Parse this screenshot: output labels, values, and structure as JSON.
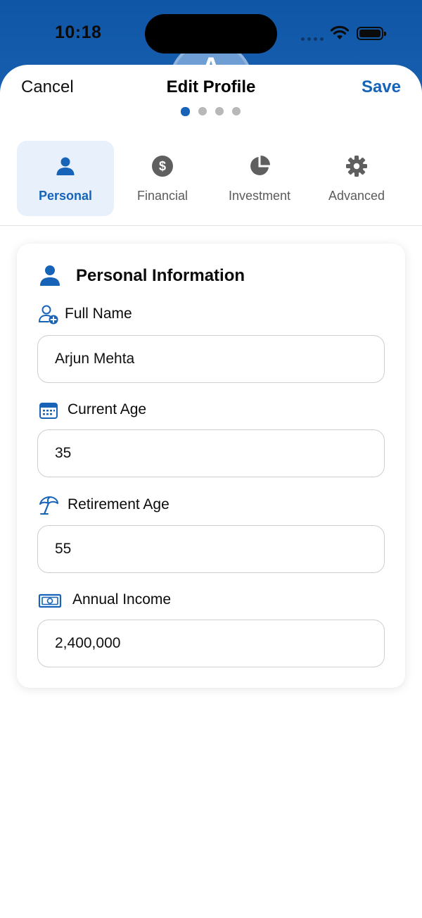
{
  "status_bar": {
    "time": "10:18"
  },
  "avatar": {
    "initial": "A"
  },
  "header": {
    "cancel_label": "Cancel",
    "title": "Edit Profile",
    "save_label": "Save",
    "steps": {
      "count": 4,
      "current": 1
    }
  },
  "tabs": [
    {
      "label": "Personal",
      "icon": "person-icon",
      "active": true
    },
    {
      "label": "Financial",
      "icon": "dollar-circle-icon",
      "active": false
    },
    {
      "label": "Investment",
      "icon": "pie-chart-icon",
      "active": false
    },
    {
      "label": "Advanced",
      "icon": "gear-icon",
      "active": false
    }
  ],
  "section": {
    "title": "Personal Information",
    "icon": "person-icon",
    "fields": [
      {
        "label": "Full Name",
        "value": "Arjun Mehta",
        "icon": "person-add-icon"
      },
      {
        "label": "Current Age",
        "value": "35",
        "icon": "calendar-icon"
      },
      {
        "label": "Retirement Age",
        "value": "55",
        "icon": "beach-umbrella-icon"
      },
      {
        "label": "Annual Income",
        "value": "2,400,000",
        "icon": "banknote-icon"
      }
    ]
  },
  "colors": {
    "accent": "#1763b8",
    "header_blue": "#0f56a6",
    "active_tab_bg": "#e8f0fb",
    "inactive_icon": "#5f5f5f"
  }
}
